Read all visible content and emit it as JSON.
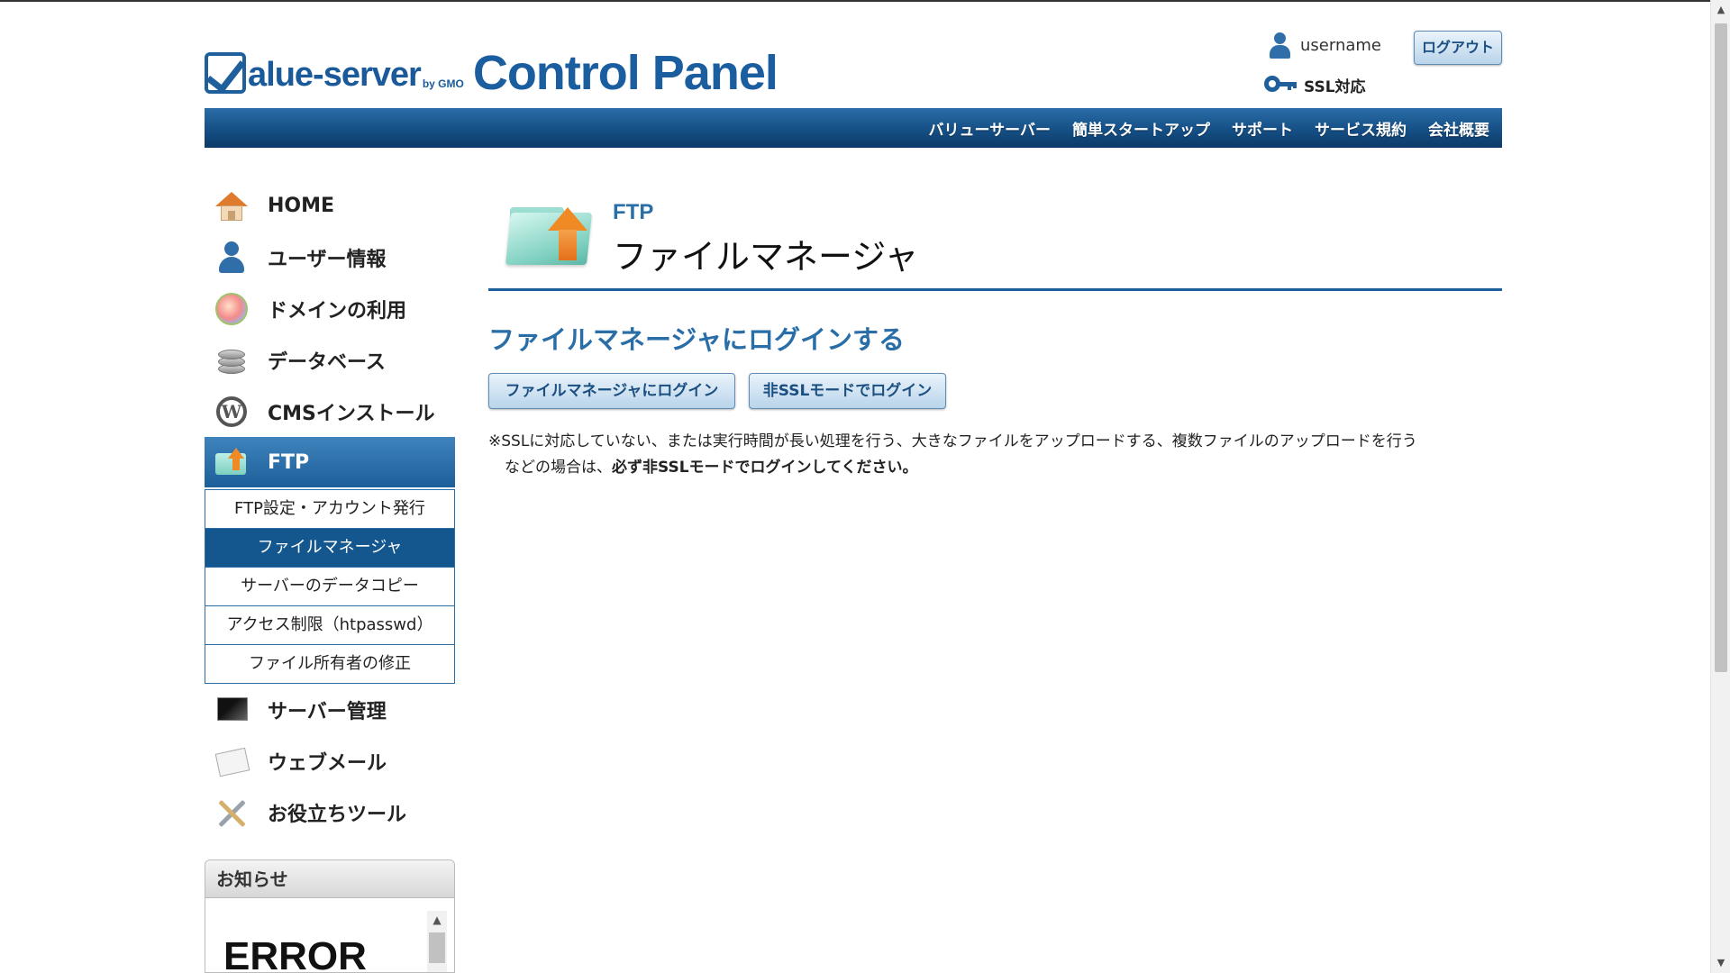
{
  "header": {
    "logo_value_server": "alue-server",
    "logo_gmo": "by GMO",
    "logo_control_panel": "Control Panel",
    "username": "username",
    "logout_label": "ログアウト",
    "ssl_label": "SSL対応"
  },
  "topnav": {
    "items": [
      "バリューサーバー",
      "簡単スタートアップ",
      "サポート",
      "サービス規約",
      "会社概要"
    ]
  },
  "sidebar": {
    "items": [
      {
        "label": "HOME",
        "icon": "home-icon"
      },
      {
        "label": "ユーザー情報",
        "icon": "user-icon"
      },
      {
        "label": "ドメインの利用",
        "icon": "globe-icon"
      },
      {
        "label": "データベース",
        "icon": "database-icon"
      },
      {
        "label": "CMSインストール",
        "icon": "wordpress-icon"
      },
      {
        "label": "FTP",
        "icon": "ftp-folder-icon",
        "active": true
      },
      {
        "label": "サーバー管理",
        "icon": "server-icon"
      },
      {
        "label": "ウェブメール",
        "icon": "mail-icon"
      },
      {
        "label": "お役立ちツール",
        "icon": "tools-icon"
      }
    ],
    "ftp_submenu": [
      {
        "label": "FTP設定・アカウント発行"
      },
      {
        "label": "ファイルマネージャ",
        "selected": true
      },
      {
        "label": "サーバーのデータコピー"
      },
      {
        "label": "アクセス制限（htpasswd）"
      },
      {
        "label": "ファイル所有者の修正"
      }
    ]
  },
  "news": {
    "title": "お知らせ",
    "content_text": "ERROR"
  },
  "main": {
    "category": "FTP",
    "title": "ファイルマネージャ",
    "section_title": "ファイルマネージャにログインする",
    "login_button": "ファイルマネージャにログイン",
    "non_ssl_button": "非SSLモードでログイン",
    "note_line1": "※SSLに対応していない、または実行時間が長い処理を行う、大きなファイルをアップロードする、複数ファイルのアップロードを行う",
    "note_line2_prefix": "などの場合は、",
    "note_line2_bold": "必ず非SSLモードでログインしてください。"
  },
  "colors": {
    "brand_blue": "#1a5e9f",
    "nav_gradient_top": "#2a6da8",
    "nav_gradient_bottom": "#0c3b68",
    "selected_sub": "#14578f",
    "accent_orange": "#f08a24"
  }
}
